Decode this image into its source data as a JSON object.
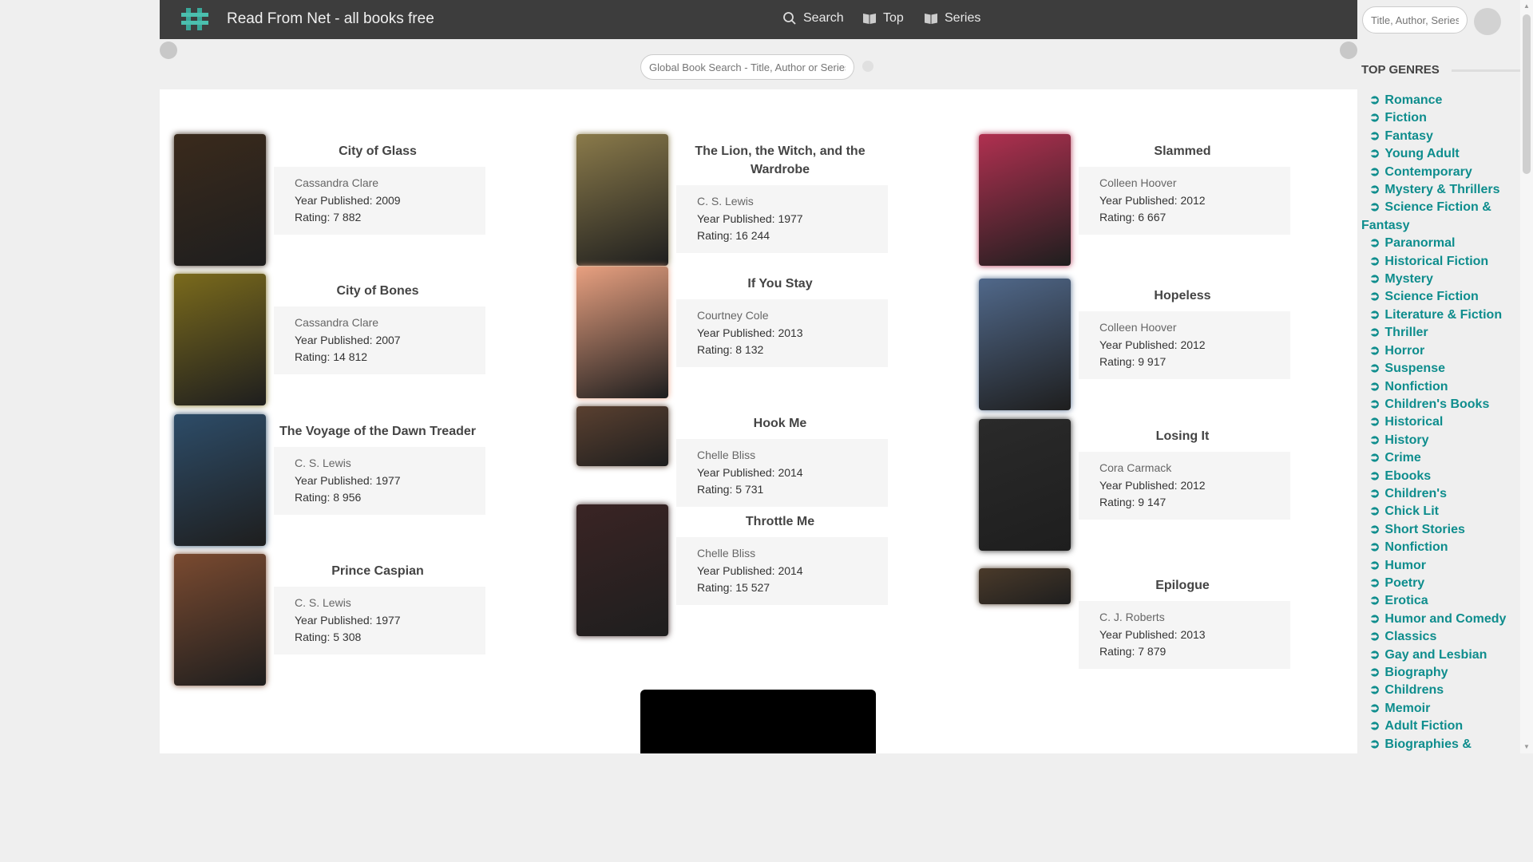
{
  "header": {
    "site_title": "Read From Net - all books free",
    "nav": {
      "search": "Search",
      "top": "Top",
      "series": "Series"
    },
    "search_placeholder": "Title, Author, Series"
  },
  "global_search": {
    "placeholder": "Global Book Search - Title, Author or Series"
  },
  "labels": {
    "year": "Year Published: ",
    "rating": "Rating: "
  },
  "books": [
    {
      "title": "City of Glass",
      "author": "Cassandra Clare",
      "year": "2009",
      "rating": "7 882",
      "cover_color": "#3a2a1c"
    },
    {
      "title": "City of Bones",
      "author": "Cassandra Clare",
      "year": "2007",
      "rating": "14 812",
      "cover_color": "#7a6a1c"
    },
    {
      "title": "The Voyage of the Dawn Treader",
      "author": "C. S. Lewis",
      "year": "1977",
      "rating": "8 956",
      "cover_color": "#2d4c68"
    },
    {
      "title": "Prince Caspian",
      "author": "C. S. Lewis",
      "year": "1977",
      "rating": "5 308",
      "cover_color": "#7a4a30"
    },
    {
      "title": "The Lion, the Witch, and the Wardrobe",
      "author": "C. S. Lewis",
      "year": "1977",
      "rating": "16 244",
      "cover_color": "#8a7a4a"
    },
    {
      "title": "If You Stay",
      "author": "Courtney Cole",
      "year": "2013",
      "rating": "8 132",
      "cover_color": "#e8a080"
    },
    {
      "title": "Hook Me",
      "author": "Chelle Bliss",
      "year": "2014",
      "rating": "5 731",
      "cover_color": "#5a4030"
    },
    {
      "title": "Throttle Me",
      "author": "Chelle Bliss",
      "year": "2014",
      "rating": "15 527",
      "cover_color": "#3a2424"
    },
    {
      "title": "Slammed",
      "author": "Colleen Hoover",
      "year": "2012",
      "rating": "6 667",
      "cover_color": "#b03050"
    },
    {
      "title": "Hopeless",
      "author": "Colleen Hoover",
      "year": "2012",
      "rating": "9 917",
      "cover_color": "#50688a"
    },
    {
      "title": "Losing It",
      "author": "Cora Carmack",
      "year": "2012",
      "rating": "9 147",
      "cover_color": "#2a2a2a"
    },
    {
      "title": "Epilogue",
      "author": "C. J. Roberts",
      "year": "2013",
      "rating": "7 879",
      "cover_color": "#4a3a2a"
    }
  ],
  "sidebar": {
    "heading": "TOP GENRES",
    "genres": [
      "Romance",
      "Fiction",
      "Fantasy",
      "Young Adult",
      "Contemporary",
      "Mystery & Thrillers",
      "Science Fiction & Fantasy",
      "Paranormal",
      "Historical Fiction",
      "Mystery",
      "Science Fiction",
      "Literature & Fiction",
      "Thriller",
      "Horror",
      "Suspense",
      "Nonfiction",
      "Children's Books",
      "Historical",
      "History",
      "Crime",
      "Ebooks",
      "Children's",
      "Chick Lit",
      "Short Stories",
      "Nonfiction",
      "Humor",
      "Poetry",
      "Erotica",
      "Humor and Comedy",
      "Classics",
      "Gay and Lesbian",
      "Biography",
      "Childrens",
      "Memoir",
      "Adult Fiction",
      "Biographies &"
    ]
  },
  "colors": {
    "header_bg": "#3d3d3d",
    "genre_link": "#0e8d8d",
    "panel_bg": "#ffffff",
    "page_bg": "#efefef"
  }
}
